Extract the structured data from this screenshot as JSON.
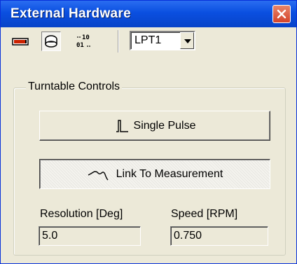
{
  "window": {
    "title": "External Hardware"
  },
  "toolbar": {
    "buttons": [
      {
        "icon": "hardware-icon",
        "pressed": false
      },
      {
        "icon": "turntable-icon",
        "pressed": true
      },
      {
        "icon": "binary-io-icon",
        "pressed": false
      }
    ],
    "binary_icon_top": "10",
    "binary_icon_bottom": "01",
    "port_select": {
      "value": "LPT1"
    }
  },
  "turntable": {
    "group_label": "Turntable Controls",
    "single_pulse_label": "Single Pulse",
    "link_label": "Link To Measurement",
    "link_checked": true,
    "resolution": {
      "label": "Resolution [Deg]",
      "value": "5.0"
    },
    "speed": {
      "label": "Speed [RPM]",
      "value": "0.750"
    }
  },
  "colors": {
    "titlebar": "#0a4fe0",
    "window_bg": "#ece9d8",
    "close_button": "#d4432a"
  }
}
